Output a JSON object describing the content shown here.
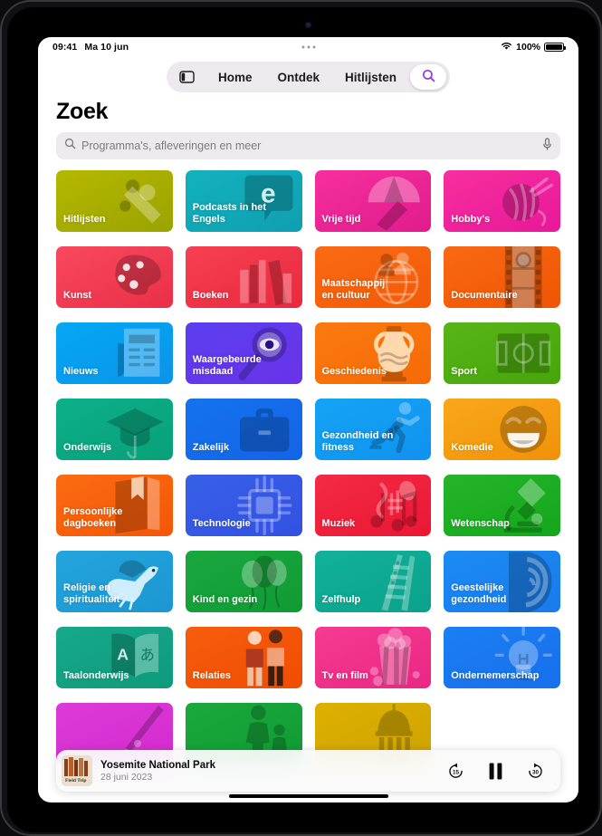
{
  "statusbar": {
    "time": "09:41",
    "date": "Ma 10 jun",
    "battery": "100%",
    "wifi_icon": "wifi-icon",
    "battery_icon": "battery-icon"
  },
  "topnav": {
    "sidebar_icon": "sidebar-toggle-icon",
    "items": [
      {
        "label": "Home",
        "name": "tab-home"
      },
      {
        "label": "Ontdek",
        "name": "tab-ontdek"
      },
      {
        "label": "Hitlijsten",
        "name": "tab-hitlijsten"
      }
    ],
    "search_tab_icon": "search-icon",
    "accent": "#9b3ae0"
  },
  "header": {
    "title": "Zoek"
  },
  "search": {
    "placeholder": "Programma's, afleveringen en meer",
    "value": "",
    "icon": "search-icon",
    "mic_icon": "microphone-icon"
  },
  "categories": [
    {
      "label": "Hitlijsten",
      "icon": "charts-icon",
      "c1": "#b5b800",
      "c2": "#9aa300"
    },
    {
      "label": "Podcasts in het Engels",
      "icon": "speech-bubble-e-icon",
      "c1": "#12b2bf",
      "c2": "#0f9fb0"
    },
    {
      "label": "Vrije tijd",
      "icon": "umbrella-icon",
      "c1": "#f72f9e",
      "c2": "#e01b8c"
    },
    {
      "label": "Hobby's",
      "icon": "yarn-ball-icon",
      "c1": "#f72f9e",
      "c2": "#e8189a"
    },
    {
      "label": "Kunst",
      "icon": "paint-palette-icon",
      "c1": "#f9495e",
      "c2": "#ea2f48"
    },
    {
      "label": "Boeken",
      "icon": "books-icon",
      "c1": "#f74052",
      "c2": "#e9293f"
    },
    {
      "label": "Maatschappij en cultuur",
      "icon": "globe-people-icon",
      "c1": "#fb6a14",
      "c2": "#f25a06"
    },
    {
      "label": "Documentaire",
      "icon": "film-strip-icon",
      "c1": "#f96913",
      "c2": "#ef5504"
    },
    {
      "label": "Nieuws",
      "icon": "newspaper-icon",
      "c1": "#04a8f4",
      "c2": "#0b93ea"
    },
    {
      "label": "Waargebeurde misdaad",
      "icon": "magnifier-eye-icon",
      "c1": "#5b3ef0",
      "c2": "#6a33e8"
    },
    {
      "label": "Geschiedenis",
      "icon": "amphora-icon",
      "c1": "#fb7a11",
      "c2": "#f56a06"
    },
    {
      "label": "Sport",
      "icon": "soccer-field-icon",
      "c1": "#57b518",
      "c2": "#46a509"
    },
    {
      "label": "Onderwijs",
      "icon": "graduation-cap-icon",
      "c1": "#0cb08a",
      "c2": "#08a079"
    },
    {
      "label": "Zakelijk",
      "icon": "briefcase-icon",
      "c1": "#1473ee",
      "c2": "#1464e6"
    },
    {
      "label": "Gezondheid en fitness",
      "icon": "runner-icon",
      "c1": "#14a4f5",
      "c2": "#1092ef"
    },
    {
      "label": "Komedie",
      "icon": "laughing-face-icon",
      "c1": "#f9a81b",
      "c2": "#f09109"
    },
    {
      "label": "Persoonlijke dagboeken",
      "icon": "journal-icon",
      "c1": "#fb6b12",
      "c2": "#f45706"
    },
    {
      "label": "Technologie",
      "icon": "microchip-icon",
      "c1": "#3860e8",
      "c2": "#3351e2"
    },
    {
      "label": "Muziek",
      "icon": "music-notes-icon",
      "c1": "#f42a46",
      "c2": "#ea1733"
    },
    {
      "label": "Wetenschap",
      "icon": "microscope-icon",
      "c1": "#23b52a",
      "c2": "#16a61d"
    },
    {
      "label": "Religie en spiritualiteit",
      "icon": "dove-icon",
      "c1": "#23a5dc",
      "c2": "#1c96d2"
    },
    {
      "label": "Kind en gezin",
      "icon": "balloons-icon",
      "c1": "#19a83e",
      "c2": "#119a34"
    },
    {
      "label": "Zelfhulp",
      "icon": "ladder-icon",
      "c1": "#12b19a",
      "c2": "#0ba28c"
    },
    {
      "label": "Geestelijke gezondheid",
      "icon": "head-profile-icon",
      "c1": "#1b8bf3",
      "c2": "#1a7bec"
    },
    {
      "label": "Taalonderwijs",
      "icon": "open-book-letters-icon",
      "c1": "#16a98a",
      "c2": "#0f9a7c"
    },
    {
      "label": "Relaties",
      "icon": "two-people-icon",
      "c1": "#f75d0d",
      "c2": "#f04c03"
    },
    {
      "label": "Tv en film",
      "icon": "popcorn-icon",
      "c1": "#f53b92",
      "c2": "#ea2684"
    },
    {
      "label": "Ondernemerschap",
      "icon": "lightbulb-icon",
      "c1": "#1b7ff3",
      "c2": "#176fec"
    },
    {
      "label": "",
      "icon": "fountain-pen-icon",
      "c1": "#dc3ad8",
      "c2": "#d42bce"
    },
    {
      "label": "",
      "icon": "parent-child-icon",
      "c1": "#19a93c",
      "c2": "#119b33"
    },
    {
      "label": "",
      "icon": "capitol-dome-icon",
      "c1": "#ddb000",
      "c2": "#cfa300"
    }
  ],
  "nowplaying": {
    "title": "Yosemite National Park",
    "subtitle": "28 juni 2023",
    "artwork_icon": "podcast-artwork",
    "artwork_caption": "Field Trip",
    "skip_back": "15",
    "skip_forward": "30",
    "pause_icon": "pause-icon",
    "skip_back_icon": "skip-back-15-icon",
    "skip_forward_icon": "skip-forward-30-icon"
  }
}
